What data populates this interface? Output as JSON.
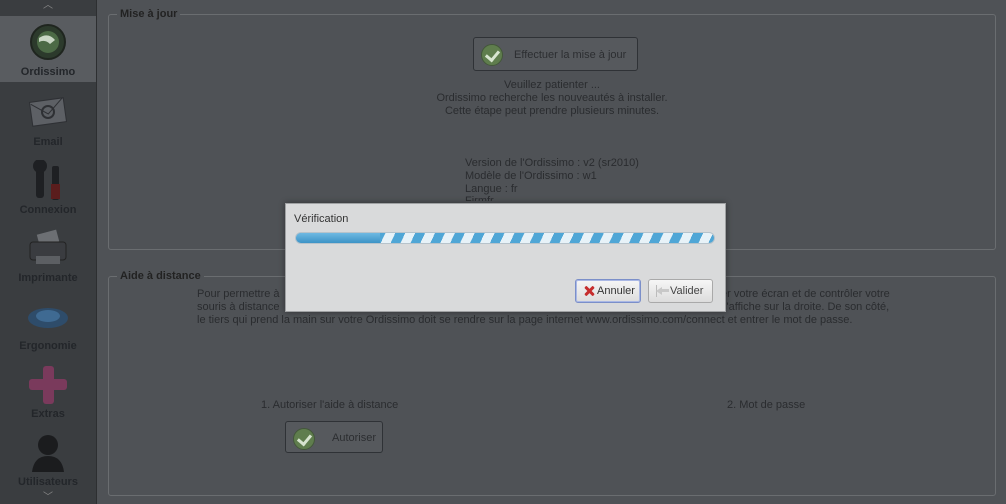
{
  "sidebar": {
    "scroll_up": "︿",
    "scroll_down": "﹀",
    "items": [
      {
        "label": "Ordissimo",
        "icon": "ordissimo-logo-icon",
        "active": true
      },
      {
        "label": "Email",
        "icon": "envelope-icon"
      },
      {
        "label": "Connexion",
        "icon": "tools-icon"
      },
      {
        "label": "Imprimante",
        "icon": "printer-icon"
      },
      {
        "label": "Ergonomie",
        "icon": "mouse-icon"
      },
      {
        "label": "Extras",
        "icon": "plus-icon"
      },
      {
        "label": "Utilisateurs",
        "icon": "user-icon"
      }
    ]
  },
  "update_section": {
    "title": "Mise à jour",
    "button_label": "Effectuer la mise à jour",
    "messages": [
      "Veuillez patienter ...",
      "Ordissimo recherche les nouveautés à installer.",
      "Cette étape peut prendre plusieurs minutes."
    ],
    "version": "Version de l'Ordissimo : v2 (sr2010)",
    "model": "Modèle de l'Ordissimo : w1",
    "language": "Langue : fr",
    "extra": "Firmfr"
  },
  "remote_section": {
    "title": "Aide à distance",
    "paragraph_line1_left": "Pour permettre à",
    "paragraph_line1_right": "er votre écran et de contrôler votre",
    "paragraph_line2_left": "souris à distance",
    "paragraph_line2_right": "s'affiche sur la droite. De son côté,",
    "paragraph_line3": "le tiers qui prend la main sur votre Ordissimo doit se rendre sur la page internet www.ordissimo.com/connect et entrer le mot de passe.",
    "step1": "1. Autoriser l'aide à distance",
    "step2": "2. Mot de passe",
    "authorize_button": "Autoriser"
  },
  "dialog": {
    "title": "Vérification",
    "progress": 0.2,
    "cancel_label": "Annuler",
    "ok_label": "Valider"
  }
}
